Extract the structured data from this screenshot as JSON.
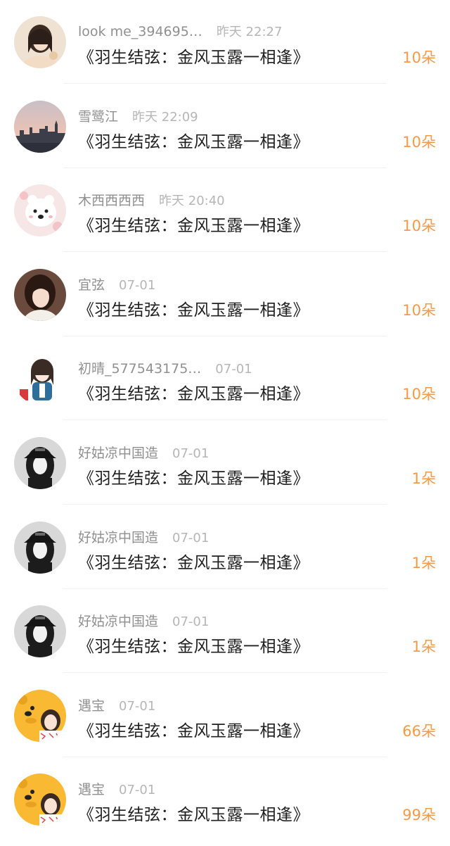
{
  "records": [
    {
      "user": "look me_394695…",
      "time": "昨天 22:27",
      "title": "《羽生结弦：金风玉露一相逢》",
      "gift": "10朵",
      "avatar": "avatar-girl-icon"
    },
    {
      "user": "雪鹭江",
      "time": "昨天 22:09",
      "title": "《羽生结弦：金风玉露一相逢》",
      "gift": "10朵",
      "avatar": "avatar-city-sunset-icon"
    },
    {
      "user": "木西西西西",
      "time": "昨天 20:40",
      "title": "《羽生结弦：金风玉露一相逢》",
      "gift": "10朵",
      "avatar": "avatar-bear-icon"
    },
    {
      "user": "宜弦",
      "time": "07-01",
      "title": "《羽生结弦：金风玉露一相逢》",
      "gift": "10朵",
      "avatar": "avatar-woman-portrait-icon"
    },
    {
      "user": "初晴_577543175…",
      "time": "07-01",
      "title": "《羽生结弦：金风玉露一相逢》",
      "gift": "10朵",
      "avatar": "avatar-anime-girl-icon"
    },
    {
      "user": "好姑凉中国造",
      "time": "07-01",
      "title": "《羽生结弦：金风玉露一相逢》",
      "gift": "1朵",
      "avatar": "avatar-cap-girl-icon"
    },
    {
      "user": "好姑凉中国造",
      "time": "07-01",
      "title": "《羽生结弦：金风玉露一相逢》",
      "gift": "1朵",
      "avatar": "avatar-cap-girl-icon"
    },
    {
      "user": "好姑凉中国造",
      "time": "07-01",
      "title": "《羽生结弦：金风玉露一相逢》",
      "gift": "1朵",
      "avatar": "avatar-cap-girl-icon"
    },
    {
      "user": "遇宝",
      "time": "07-01",
      "title": "《羽生结弦：金风玉露一相逢》",
      "gift": "66朵",
      "avatar": "avatar-pooh-icon"
    },
    {
      "user": "遇宝",
      "time": "07-01",
      "title": "《羽生结弦：金风玉露一相逢》",
      "gift": "99朵",
      "avatar": "avatar-pooh-icon"
    }
  ],
  "colors": {
    "gift": "#f39a4b",
    "username": "#909090",
    "time": "#b6b6b6",
    "title": "#1f1f1f"
  }
}
